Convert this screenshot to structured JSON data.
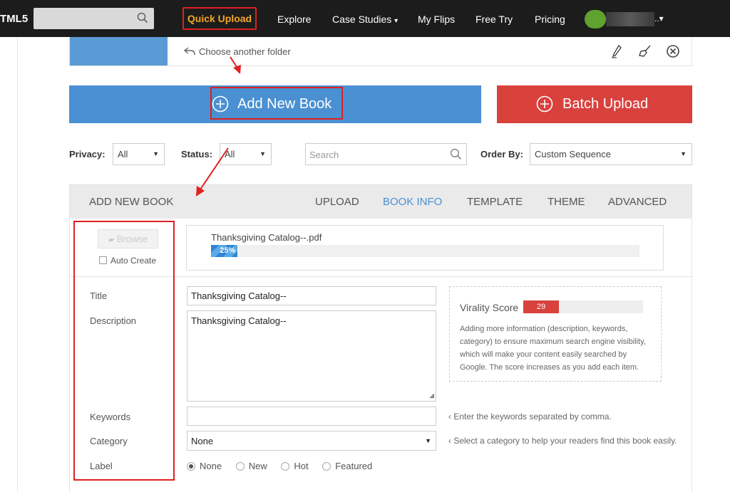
{
  "nav": {
    "logo": "TML5",
    "search_placeholder": "",
    "items": [
      "Quick Upload",
      "Explore",
      "Case Studies",
      "My Flips",
      "Free Try",
      "Pricing"
    ],
    "case_studies_caret": "▾",
    "user_caret": "..▾"
  },
  "folder": {
    "choose_label": "Choose another folder"
  },
  "actions": {
    "add_new_book": "Add New Book",
    "batch_upload": "Batch Upload"
  },
  "filters": {
    "privacy_label": "Privacy:",
    "privacy_value": "All",
    "status_label": "Status:",
    "status_value": "All",
    "search_placeholder": "Search",
    "order_label": "Order By:",
    "order_value": "Custom Sequence"
  },
  "panel": {
    "heading": "ADD NEW BOOK",
    "tabs": [
      "UPLOAD",
      "BOOK INFO",
      "TEMPLATE",
      "THEME",
      "ADVANCED"
    ],
    "active_tab": "BOOK INFO"
  },
  "upload": {
    "browse_label": "Browse",
    "auto_create_label": "Auto Create",
    "file_name": "Thanksgiving Catalog--.pdf",
    "progress_fraction": 0.25,
    "progress_label": "25%"
  },
  "form": {
    "title_label": "Title",
    "title_value": "Thanksgiving Catalog--",
    "description_label": "Description",
    "description_value": "Thanksgiving Catalog--",
    "keywords_label": "Keywords",
    "keywords_value": "",
    "keywords_hint": "‹ Enter the keywords separated by comma.",
    "category_label": "Category",
    "category_value": "None",
    "category_hint": "‹ Select a category to help your readers find this book easily.",
    "label_label": "Label",
    "label_options": [
      "None",
      "New",
      "Hot",
      "Featured"
    ],
    "label_selected": "None"
  },
  "virality": {
    "label": "Virality Score",
    "score": 29,
    "text": "Adding more information (description, keywords, category) to ensure maximum search engine visibility, which will make your content easily searched by Google. The score increases as you add each item."
  },
  "colors": {
    "nav_bg": "#1c1c1c",
    "quick_upload": "#f5a623",
    "primary_blue": "#4a90d2",
    "batch_red": "#d9413d",
    "highlight_red": "#e02020"
  }
}
